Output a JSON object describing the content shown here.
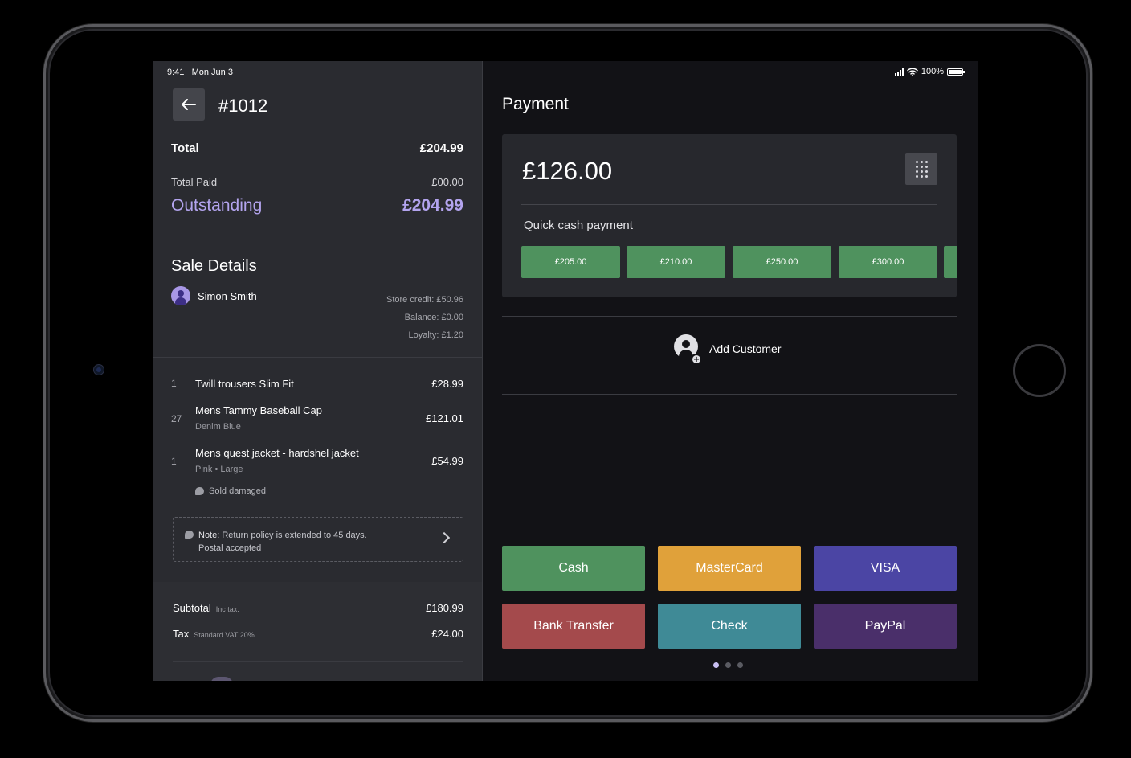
{
  "status": {
    "time": "9:41",
    "date": "Mon Jun 3",
    "battery": "100%"
  },
  "order": {
    "number": "#1012"
  },
  "totals": {
    "total_label": "Total",
    "total_value": "£204.99",
    "paid_label": "Total Paid",
    "paid_value": "£00.00",
    "outstanding_label": "Outstanding",
    "outstanding_value": "£204.99"
  },
  "sale": {
    "title": "Sale Details",
    "customer_name": "Simon Smith",
    "store_credit": "Store credit: £50.96",
    "balance": "Balance: £0.00",
    "loyalty": "Loyalty: £1.20"
  },
  "items": [
    {
      "qty": "1",
      "name": "Twill trousers Slim Fit",
      "sub": "",
      "price": "£28.99"
    },
    {
      "qty": "27",
      "name": "Mens Tammy Baseball Cap",
      "sub": "Denim Blue",
      "price": "£121.01"
    },
    {
      "qty": "1",
      "name": "Mens quest jacket - hardshel jacket",
      "sub": "Pink • Large",
      "price": "£54.99",
      "tag": "Sold damaged"
    }
  ],
  "note": {
    "label": "Note:",
    "text": " Return policy is extended to 45 days.",
    "text2": "Postal accepted"
  },
  "summary": {
    "subtotal_label": "Subtotal",
    "subtotal_note": "Inc tax.",
    "subtotal_value": "£180.99",
    "tax_label": "Tax",
    "tax_note": "Standard VAT 20%",
    "tax_value": "£24.00"
  },
  "payment": {
    "title": "Payment",
    "amount": "£126.00",
    "quick_label": "Quick cash payment",
    "quick_amounts": [
      "£205.00",
      "£210.00",
      "£250.00",
      "£300.00"
    ],
    "add_customer": "Add Customer",
    "methods": [
      {
        "label": "Cash",
        "color": "#4f925e"
      },
      {
        "label": "MasterCard",
        "color": "#e0a13a"
      },
      {
        "label": "VISA",
        "color": "#4b45a4"
      },
      {
        "label": "Bank Transfer",
        "color": "#a44a4c"
      },
      {
        "label": "Check",
        "color": "#3f8a96"
      },
      {
        "label": "PayPal",
        "color": "#4a2f6a"
      }
    ],
    "page_dots": {
      "count": 3,
      "active": 1
    }
  }
}
